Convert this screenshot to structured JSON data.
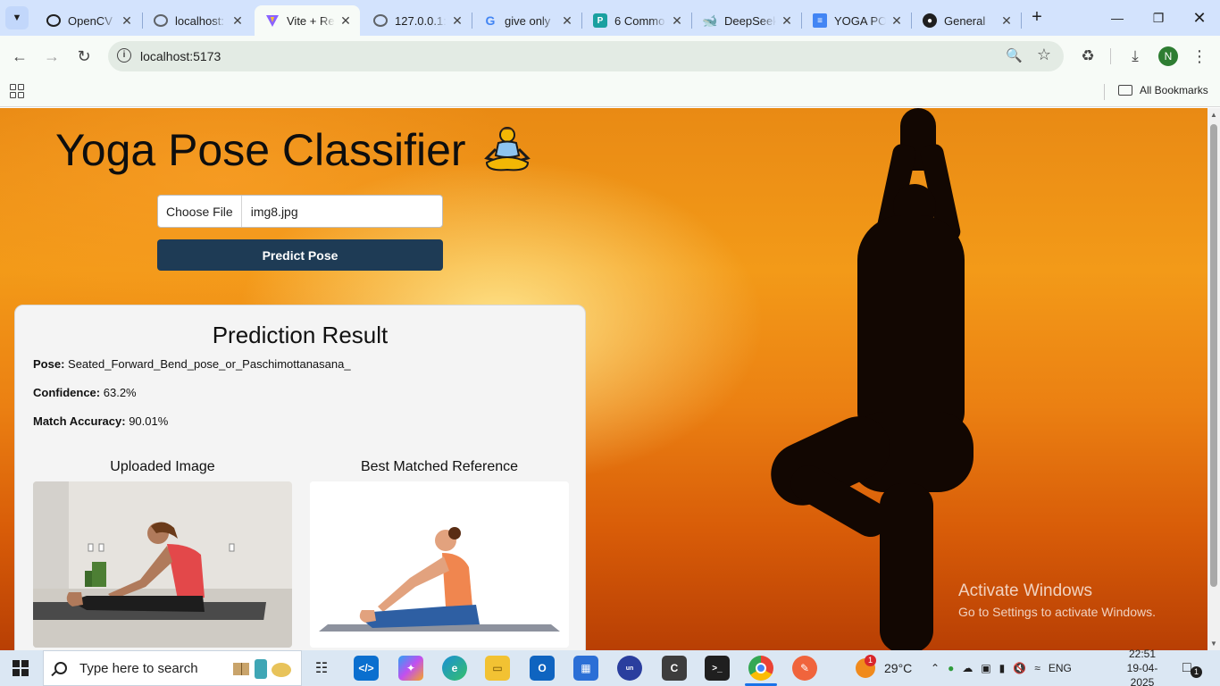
{
  "browser": {
    "tabs": [
      {
        "title": "OpenCV |",
        "favicon": "openai-icon",
        "color": "#1f1f1f",
        "active": false
      },
      {
        "title": "localhost:",
        "favicon": "globe-icon",
        "color": "#5f6368",
        "active": false
      },
      {
        "title": "Vite + Re",
        "favicon": "vite-icon",
        "color": "#8a62ff",
        "active": true
      },
      {
        "title": "127.0.0.1:",
        "favicon": "globe-icon",
        "color": "#5f6368",
        "active": false
      },
      {
        "title": "give only",
        "favicon": "google-icon",
        "color": "#4285f4",
        "active": false
      },
      {
        "title": "6 Commo",
        "favicon": "p-icon",
        "color": "#1aa0a0",
        "active": false
      },
      {
        "title": "DeepSeek",
        "favicon": "deepseek-icon",
        "color": "#4d6bfe",
        "active": false
      },
      {
        "title": "YOGA PO",
        "favicon": "docs-icon",
        "color": "#4285f4",
        "active": false
      },
      {
        "title": "General",
        "favicon": "github-icon",
        "color": "#1f1f1f",
        "active": false
      }
    ],
    "url": "localhost:5173",
    "profile_initial": "N",
    "bookmarks_label": "All Bookmarks"
  },
  "page": {
    "title": "Yoga Pose Classifier",
    "file_button_label": "Choose File",
    "file_name": "img8.jpg",
    "predict_label": "Predict Pose",
    "result": {
      "heading": "Prediction Result",
      "pose_label": "Pose:",
      "pose_value": "Seated_Forward_Bend_pose_or_Paschimottanasana_",
      "confidence_label": "Confidence:",
      "confidence_value": "63.2%",
      "accuracy_label": "Match Accuracy:",
      "accuracy_value": "90.01%",
      "uploaded_caption": "Uploaded Image",
      "reference_caption": "Best Matched Reference"
    },
    "watermark_title": "Activate Windows",
    "watermark_sub": "Go to Settings to activate Windows."
  },
  "taskbar": {
    "search_placeholder": "Type here to search",
    "weather_temp": "29°C",
    "weather_badge": "1",
    "language": "ENG",
    "time": "22:51",
    "date": "19-04-2025",
    "notification_count": "1"
  },
  "colors": {
    "predict_button": "#1e3b55",
    "tab_strip": "#d3e3fd",
    "accent": "#1a73e8"
  }
}
